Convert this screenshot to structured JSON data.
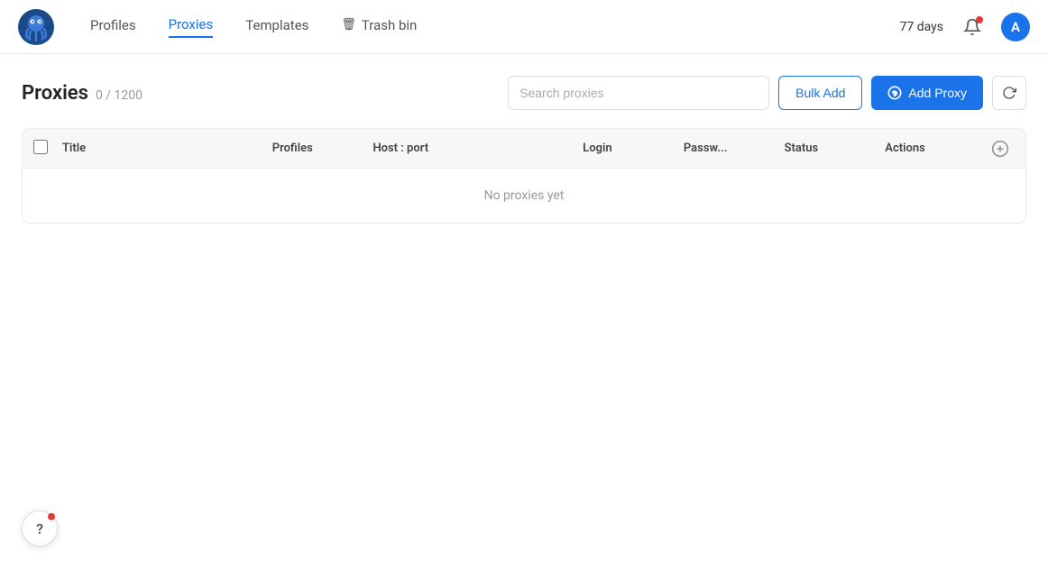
{
  "app": {
    "logo_alt": "Octo Browser Logo"
  },
  "header": {
    "nav": [
      {
        "id": "profiles",
        "label": "Profiles",
        "active": false
      },
      {
        "id": "proxies",
        "label": "Proxies",
        "active": true
      },
      {
        "id": "templates",
        "label": "Templates",
        "active": false
      },
      {
        "id": "trash",
        "label": "Trash bin",
        "active": false,
        "icon": "trash-icon"
      }
    ],
    "days": "77 days",
    "avatar_initials": "A"
  },
  "proxies_page": {
    "title": "Proxies",
    "count": "0 / 1200",
    "search_placeholder": "Search proxies",
    "bulk_add_label": "Bulk Add",
    "add_proxy_label": "Add Proxy",
    "table": {
      "columns": [
        {
          "id": "title",
          "label": "Title"
        },
        {
          "id": "profiles",
          "label": "Profiles"
        },
        {
          "id": "host_port",
          "label": "Host : port"
        },
        {
          "id": "login",
          "label": "Login"
        },
        {
          "id": "password",
          "label": "Passw..."
        },
        {
          "id": "status",
          "label": "Status"
        },
        {
          "id": "actions",
          "label": "Actions"
        }
      ],
      "empty_message": "No proxies yet",
      "rows": []
    }
  },
  "help_button": {
    "label": "?"
  }
}
